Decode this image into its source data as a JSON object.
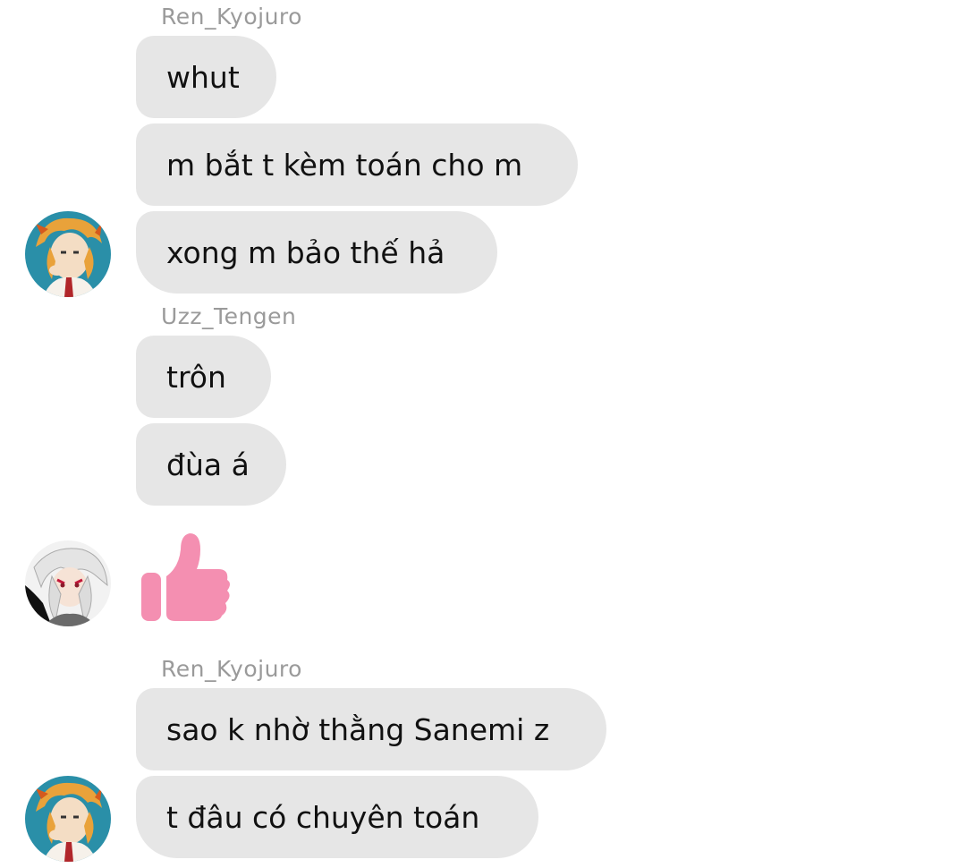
{
  "messages": {
    "group1": {
      "sender": "Ren_Kyojuro",
      "bubbles": [
        "whut",
        "m bắt t kèm toán cho m",
        "xong m bảo thế hả"
      ]
    },
    "group2": {
      "sender": "Uzz_Tengen",
      "bubbles": [
        "trôn",
        "đùa á"
      ],
      "reaction_icon": "thumbs-up-icon"
    },
    "group3": {
      "sender": "Ren_Kyojuro",
      "bubbles": [
        "sao k nhờ thằng Sanemi z",
        "t đâu có chuyên toán"
      ]
    }
  },
  "colors": {
    "bubble_bg": "#e6e6e6",
    "sender_text": "#9a9a9a",
    "thumb": "#f48fb1"
  }
}
